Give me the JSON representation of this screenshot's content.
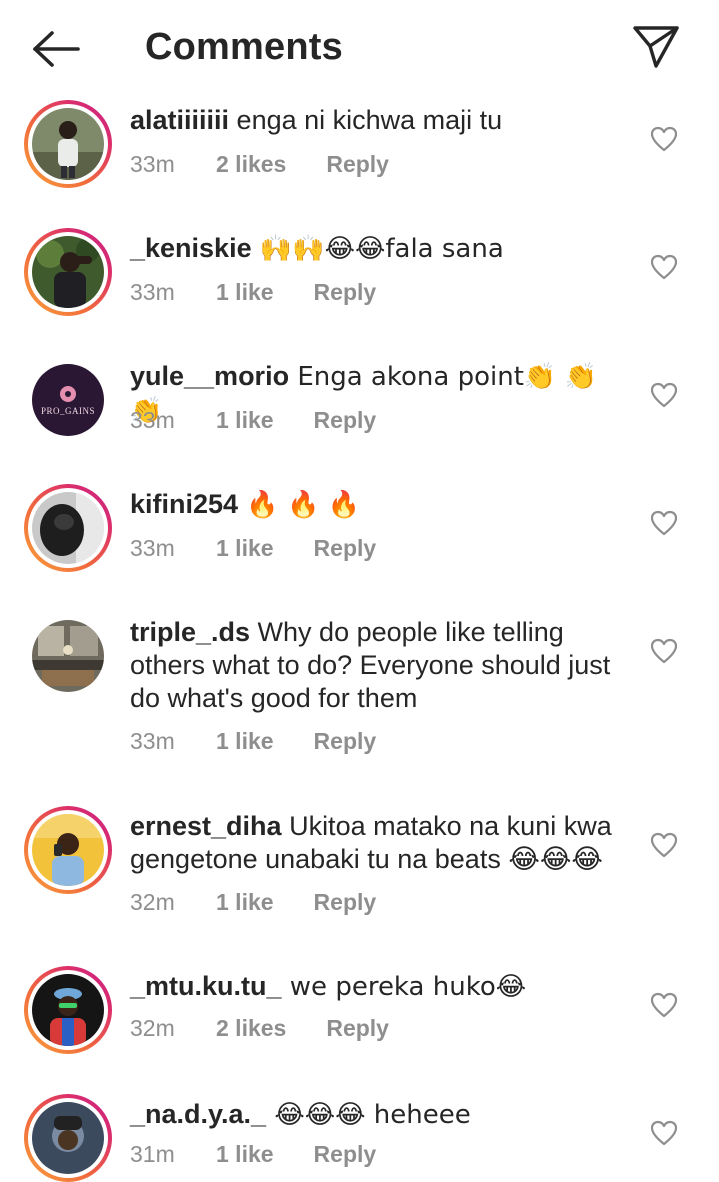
{
  "header": {
    "title": "Comments",
    "back_icon": "arrow-left-icon",
    "send_icon": "paper-plane-icon"
  },
  "colors": {
    "ring_start": "#f9a23c",
    "ring_end": "#c1208f",
    "meta_gray": "#8e8e8e",
    "text": "#262626"
  },
  "comments": [
    {
      "username": "alatiiiiiii",
      "text": " enga ni kichwa maji tu",
      "time": "33m",
      "likes": "2 likes",
      "reply": "Reply"
    },
    {
      "username": "_keniskie",
      "text": " 🙌🙌😂😂fala sana",
      "time": "33m",
      "likes": "1 like",
      "reply": "Reply"
    },
    {
      "username": "yule__morio",
      "text": " Enga akona point👏 👏 👏",
      "time": "33m",
      "likes": "1 like",
      "reply": "Reply",
      "avatar_text": "PRO_GAINS"
    },
    {
      "username": "kifini254",
      "text": " 🔥 🔥 🔥",
      "time": "33m",
      "likes": "1 like",
      "reply": "Reply"
    },
    {
      "username": "triple_.ds",
      "text": " Why do people like telling others what to do? Everyone should just do what's good for them",
      "time": "33m",
      "likes": "1 like",
      "reply": "Reply"
    },
    {
      "username": "ernest_diha",
      "text": " Ukitoa matako na kuni kwa gengetone unabaki tu na beats 😂😂😂",
      "time": "32m",
      "likes": "1 like",
      "reply": "Reply"
    },
    {
      "username": "_mtu.ku.tu_",
      "text": " we pereka huko😂",
      "time": "32m",
      "likes": "2 likes",
      "reply": "Reply"
    },
    {
      "username": "_na.d.y.a._",
      "text": " 😂😂😂 heheee",
      "time": "31m",
      "likes": "1 like",
      "reply": "Reply"
    }
  ]
}
